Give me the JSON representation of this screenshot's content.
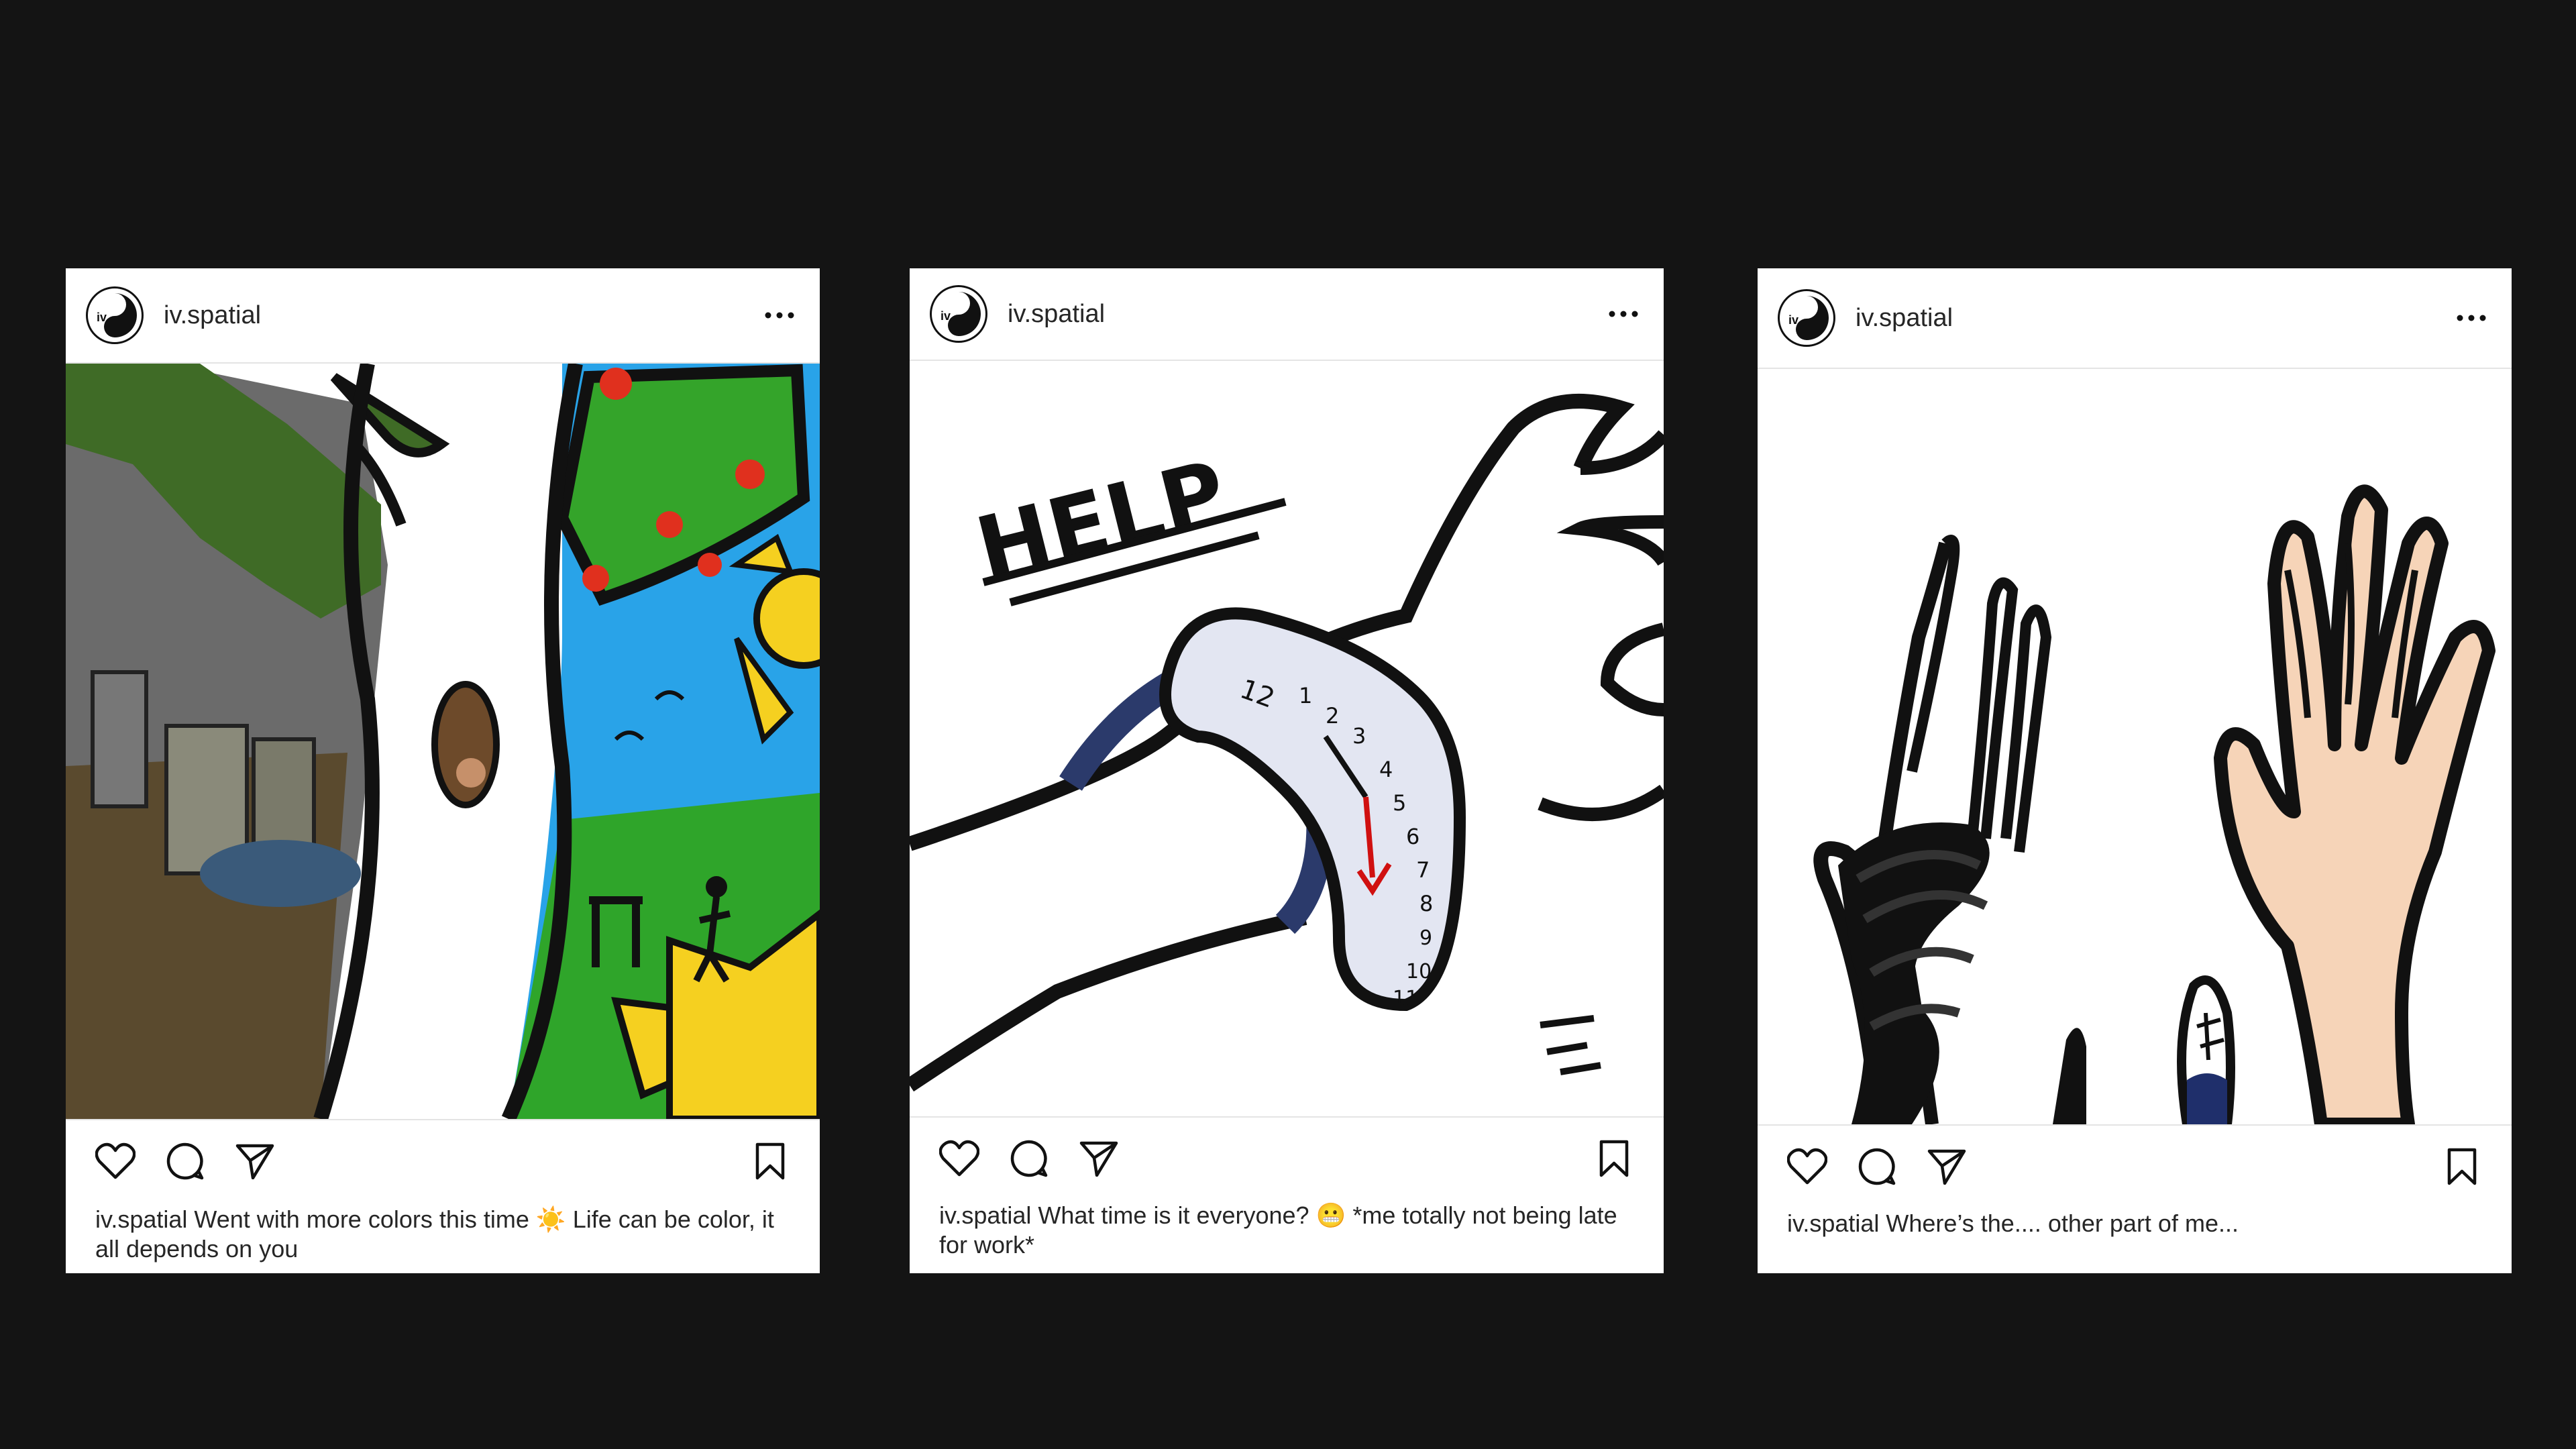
{
  "posts": [
    {
      "username": "iv.spatial",
      "caption_user": "iv.spatial",
      "caption_text": "Went with more colors this time ☀️ Life can be color, it all depends on you",
      "image_subject": "split-tree-painting"
    },
    {
      "username": "iv.spatial",
      "caption_user": "iv.spatial",
      "caption_text": "What time is it everyone? 😬 *me totally not being late for work*",
      "image_subject": "melting-clock-painting",
      "image_text": "HELP"
    },
    {
      "username": "iv.spatial",
      "caption_user": "iv.spatial",
      "caption_text": "Where’s the.... other part of me...",
      "image_subject": "hands-painting"
    }
  ],
  "icons": {
    "avatar": "avatar-logo-icon",
    "more": "more-dots-icon",
    "like": "heart-icon",
    "comment": "comment-icon",
    "share": "send-icon",
    "save": "bookmark-icon"
  },
  "colors": {
    "background": "#141414",
    "card": "#ffffff",
    "text": "#262626",
    "divider": "#e4e4e4"
  }
}
